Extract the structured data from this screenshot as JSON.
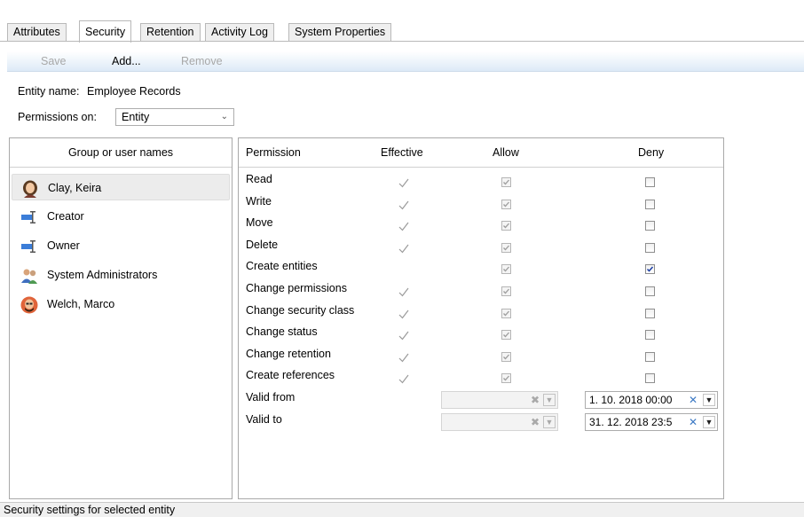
{
  "tabs": [
    {
      "label": "Attributes",
      "active": false
    },
    {
      "label": "Security",
      "active": true
    },
    {
      "label": "Retention",
      "active": false
    },
    {
      "label": "Activity Log",
      "active": false
    },
    {
      "label": "System Properties",
      "active": false
    }
  ],
  "toolbar": {
    "save_label": "Save",
    "add_label": "Add...",
    "remove_label": "Remove"
  },
  "entity": {
    "name_label": "Entity name:",
    "name_value": "Employee Records",
    "permissions_on_label": "Permissions on:",
    "permissions_on_value": "Entity"
  },
  "users": {
    "header": "Group or user names",
    "items": [
      {
        "name": "Clay, Keira",
        "icon": "user-female-avatar-icon",
        "selected": true
      },
      {
        "name": "Creator",
        "icon": "pseudo-user-icon",
        "selected": false
      },
      {
        "name": "Owner",
        "icon": "pseudo-user-icon",
        "selected": false
      },
      {
        "name": "System Administrators",
        "icon": "group-icon",
        "selected": false
      },
      {
        "name": "Welch, Marco",
        "icon": "user-male-avatar-icon",
        "selected": false
      }
    ]
  },
  "permissions": {
    "headers": {
      "permission": "Permission",
      "effective": "Effective",
      "allow": "Allow",
      "deny": "Deny"
    },
    "rows": [
      {
        "name": "Read",
        "effective": true,
        "allow": true,
        "deny": false
      },
      {
        "name": "Write",
        "effective": true,
        "allow": true,
        "deny": false
      },
      {
        "name": "Move",
        "effective": true,
        "allow": true,
        "deny": false
      },
      {
        "name": "Delete",
        "effective": true,
        "allow": true,
        "deny": false
      },
      {
        "name": "Create entities",
        "effective": false,
        "allow": true,
        "deny": true
      },
      {
        "name": "Change permissions",
        "effective": true,
        "allow": true,
        "deny": false
      },
      {
        "name": "Change security class",
        "effective": true,
        "allow": true,
        "deny": false
      },
      {
        "name": "Change status",
        "effective": true,
        "allow": true,
        "deny": false
      },
      {
        "name": "Change retention",
        "effective": true,
        "allow": true,
        "deny": false
      },
      {
        "name": "Create references",
        "effective": true,
        "allow": true,
        "deny": false
      }
    ],
    "valid_from": {
      "label": "Valid from",
      "allow_value": "",
      "deny_value": "1. 10. 2018 00:00"
    },
    "valid_to": {
      "label": "Valid to",
      "allow_value": "",
      "deny_value": "31. 12. 2018 23:5"
    }
  },
  "status": {
    "text": "Security settings for selected entity"
  },
  "colors": {
    "toolbar_gradient_end": "#ddeaf7",
    "checkbox_checked": "#1c3fa5",
    "effective_tick": "#9a9a9a",
    "clear_x": "#3c79c4"
  }
}
